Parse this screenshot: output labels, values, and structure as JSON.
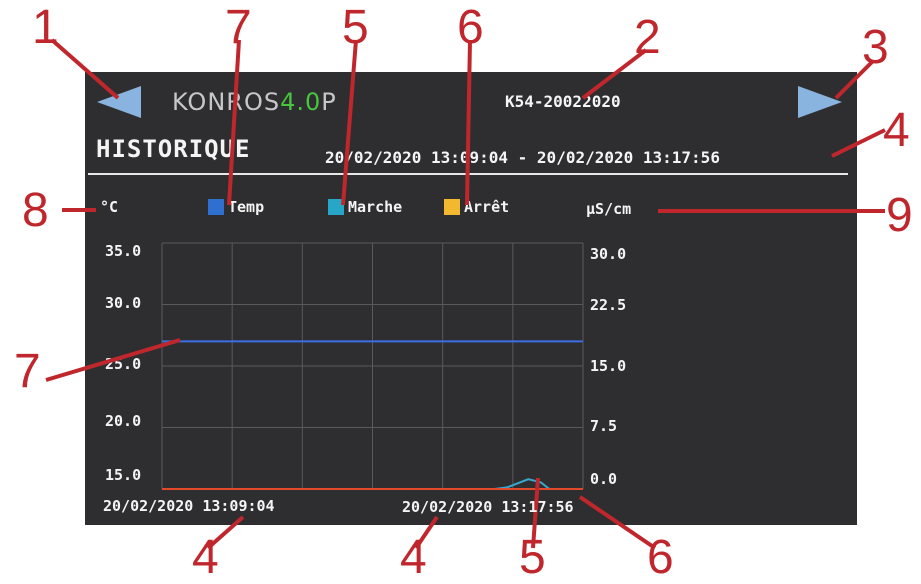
{
  "header": {
    "logo_part1": "KONROS",
    "logo_part2": "4.0",
    "logo_part3": "P",
    "device_id": "K54-20022020"
  },
  "title": "HISTORIQUE",
  "date_range": "20/02/2020 13:09:04 - 20/02/2020 13:17:56",
  "units": {
    "left": "°C",
    "right": "µS/cm"
  },
  "legend": [
    {
      "label": "Temp",
      "color": "#2f6fd0"
    },
    {
      "label": "Marche",
      "color": "#27a6c8"
    },
    {
      "label": "Arrêt",
      "color": "#f2b930"
    }
  ],
  "axis_left_ticks": [
    "35.0",
    "30.0",
    "25.0",
    "20.0",
    "15.0"
  ],
  "axis_right_ticks": [
    "30.0",
    "22.5",
    "15.0",
    "7.5",
    "0.0"
  ],
  "time_start": "20/02/2020 13:09:04",
  "time_end": "20/02/2020 13:17:56",
  "callouts": [
    "1",
    "7",
    "5",
    "6",
    "2",
    "3",
    "4",
    "8",
    "9",
    "7",
    "4",
    "4",
    "5",
    "6"
  ],
  "chart_data": {
    "type": "line",
    "y_left": {
      "unit": "°C",
      "ylim": [
        15.0,
        35.0
      ]
    },
    "y_right": {
      "unit": "µS/cm",
      "ylim": [
        0.0,
        30.0
      ]
    },
    "x_range": [
      "20/02/2020 13:09:04",
      "20/02/2020 13:17:56"
    ],
    "series": [
      {
        "name": "Temp",
        "axis": "left",
        "color": "#3b6fe6",
        "x": [
          0,
          1
        ],
        "values": [
          27.0,
          27.0
        ]
      },
      {
        "name": "Marche",
        "axis": "right",
        "color": "#38a8d0",
        "x": [
          0.79,
          0.82,
          0.87,
          0.9,
          0.92,
          1.0
        ],
        "values": [
          0.0,
          0.2,
          1.2,
          0.8,
          0.0,
          0.0
        ]
      },
      {
        "name": "Arrêt",
        "axis": "right",
        "color": "#e24a2a",
        "x": [
          0,
          1
        ],
        "values": [
          0.0,
          0.0
        ]
      }
    ],
    "grid": true
  }
}
